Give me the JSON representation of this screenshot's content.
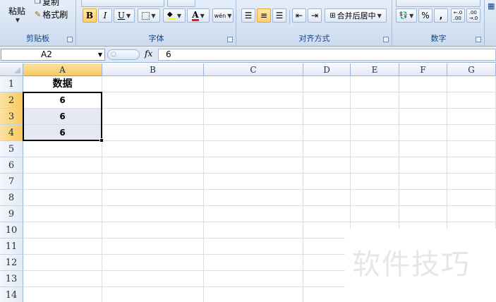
{
  "ribbon": {
    "clipboard": {
      "paste": "粘贴",
      "copy": "复制",
      "format_painter": "格式刷",
      "label": "剪贴板"
    },
    "font": {
      "bold": "B",
      "italic": "I",
      "underline": "U",
      "font_color": "A",
      "phonetic": "wén",
      "label": "字体"
    },
    "alignment": {
      "merge_center": "合并后居中",
      "label": "对齐方式"
    },
    "number": {
      "percent": "%",
      "comma": ",",
      "inc_decimal": ".00→.0",
      "dec_decimal": ".00←.0",
      "label": "数字"
    }
  },
  "formula_bar": {
    "name_box": "A2",
    "fx": "fx",
    "value": "6"
  },
  "grid": {
    "columns": [
      "A",
      "B",
      "C",
      "D",
      "E",
      "F",
      "G"
    ],
    "rows": [
      "1",
      "2",
      "3",
      "4",
      "5",
      "6",
      "7",
      "8",
      "9",
      "10",
      "11",
      "12",
      "13",
      "14"
    ],
    "cells": {
      "A1": "数据",
      "A2": "6",
      "A3": "6",
      "A4": "6"
    },
    "selected_range": "A2:A4"
  },
  "watermark": "软件技巧",
  "colors": {
    "ribbon": "#d7e4f4",
    "header_selected": "#f8c95e",
    "selection_fill": "#e6e8f3",
    "group_label": "#15428b"
  }
}
